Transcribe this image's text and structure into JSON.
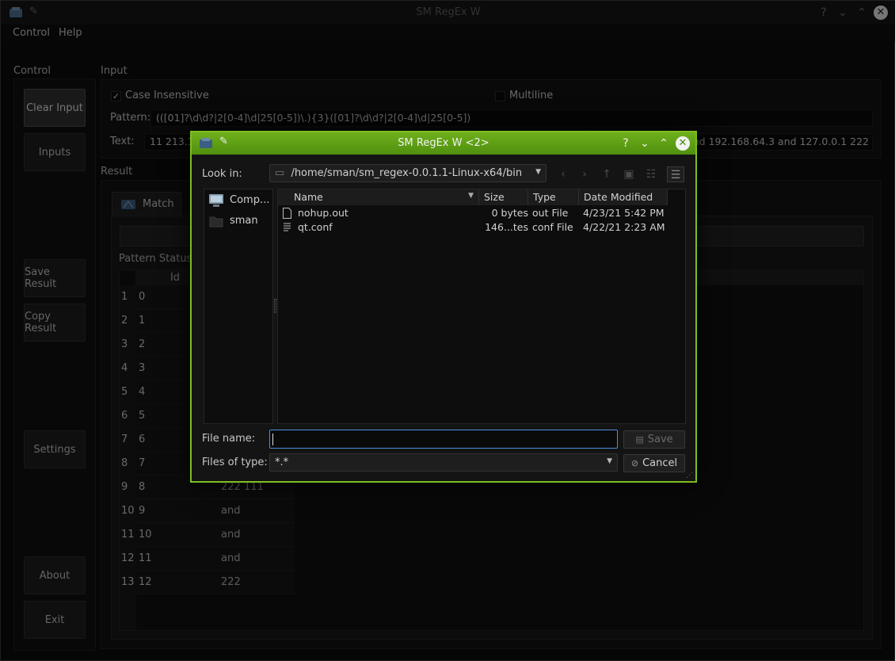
{
  "main_window": {
    "title": "SM RegEx W",
    "menu": [
      "Control",
      "Help"
    ]
  },
  "control": {
    "group_label": "Control",
    "buttons": {
      "clear_input": "Clear Input",
      "inputs": "Inputs",
      "save_result": "Save Result",
      "copy_result": "Copy Result",
      "settings": "Settings",
      "about": "About",
      "exit": "Exit"
    }
  },
  "input": {
    "group_label": "Input",
    "case_insensitive_label": "Case Insensitive",
    "case_insensitive_checked": true,
    "multiline_label": "Multiline",
    "multiline_checked": false,
    "pattern_label": "Pattern:",
    "pattern_value": "(([01]?\\d\\d?|2[0-4]\\d|25[0-5])\\.){3}([01]?\\d\\d?|2[0-4]\\d|25[0-5])",
    "text_label": "Text:",
    "text_value_left": "11 213.1",
    "text_value_right": "nd 192.168.64.3 and 127.0.0.1 222"
  },
  "result": {
    "group_label": "Result",
    "tab_match": "Match",
    "pattern_status_label": "Pattern Status:",
    "id_header": "Id",
    "rows": [
      {
        "num": "1",
        "id": "0",
        "value": ""
      },
      {
        "num": "2",
        "id": "1",
        "value": ""
      },
      {
        "num": "3",
        "id": "2",
        "value": ""
      },
      {
        "num": "4",
        "id": "3",
        "value": ""
      },
      {
        "num": "5",
        "id": "4",
        "value": ""
      },
      {
        "num": "6",
        "id": "5",
        "value": ""
      },
      {
        "num": "7",
        "id": "6",
        "value": ""
      },
      {
        "num": "8",
        "id": "7",
        "value": ""
      },
      {
        "num": "9",
        "id": "8",
        "value": "222 111"
      },
      {
        "num": "10",
        "id": "9",
        "value": "and"
      },
      {
        "num": "11",
        "id": "10",
        "value": "and"
      },
      {
        "num": "12",
        "id": "11",
        "value": "and"
      },
      {
        "num": "13",
        "id": "12",
        "value": "222"
      }
    ]
  },
  "dialog": {
    "title": "SM RegEx W <2>",
    "look_in_label": "Look in:",
    "look_in_path": "/home/sman/sm_regex-0.0.1.1-Linux-x64/bin",
    "sidebar": [
      "Comp...",
      "sman"
    ],
    "columns": {
      "name": "Name",
      "size": "Size",
      "type": "Type",
      "date": "Date Modified"
    },
    "files": [
      {
        "name": "nohup.out",
        "size": "0 bytes",
        "type": "out File",
        "date": "4/23/21 5:42 PM"
      },
      {
        "name": "qt.conf",
        "size": "146...tes",
        "type": "conf File",
        "date": "4/22/21 2:23 AM"
      }
    ],
    "file_name_label": "File name:",
    "file_name_value": "",
    "files_of_type_label": "Files of type:",
    "files_of_type_value": "*.*",
    "save_label": "Save",
    "cancel_label": "Cancel"
  }
}
